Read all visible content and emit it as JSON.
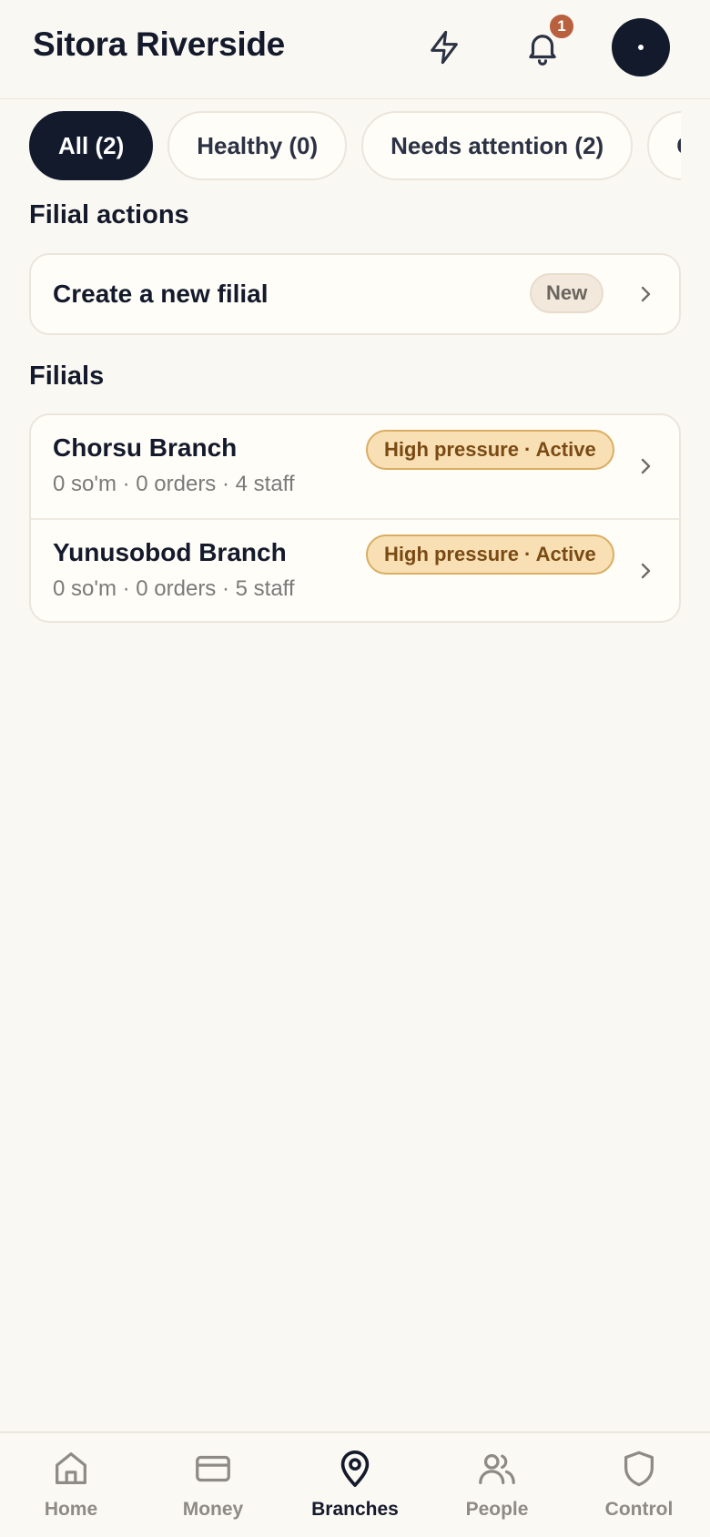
{
  "header": {
    "title": "Sitora Riverside",
    "notification_count": "1",
    "icons": {
      "quick": "bolt-icon",
      "notifications": "bell-icon",
      "avatar": "avatar"
    }
  },
  "filters": [
    {
      "label": "All (2)",
      "active": true
    },
    {
      "label": "Healthy (0)",
      "active": false
    },
    {
      "label": "Needs attention (2)",
      "active": false
    },
    {
      "label": "Cri",
      "active": false
    }
  ],
  "actions_section": {
    "title": "Filial actions",
    "items": [
      {
        "label": "Create a new filial",
        "badge": "New"
      }
    ]
  },
  "filials_section": {
    "title": "Filials",
    "items": [
      {
        "name": "Chorsu Branch",
        "meta": "0 so'm · 0 orders · 4 staff",
        "status": "High pressure · Active"
      },
      {
        "name": "Yunusobod Branch",
        "meta": "0 so'm · 0 orders · 5 staff",
        "status": "High pressure · Active"
      }
    ]
  },
  "bottom_nav": [
    {
      "label": "Home",
      "icon": "home-icon",
      "active": false
    },
    {
      "label": "Money",
      "icon": "card-icon",
      "active": false
    },
    {
      "label": "Branches",
      "icon": "map-pin-icon",
      "active": true
    },
    {
      "label": "People",
      "icon": "people-icon",
      "active": false
    },
    {
      "label": "Control",
      "icon": "shield-icon",
      "active": false
    }
  ],
  "colors": {
    "background": "#faf8f3",
    "primary_dark": "#121a2c",
    "badge": "#b9603f",
    "status_bg": "#f9e0b4",
    "status_border": "#d9ad62"
  }
}
